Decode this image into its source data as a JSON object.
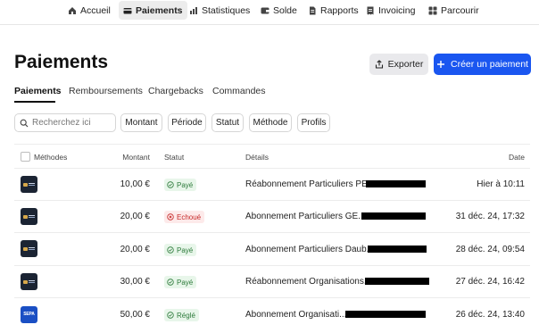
{
  "nav": {
    "items": [
      {
        "label": "Accueil",
        "icon": "home-icon"
      },
      {
        "label": "Paiements",
        "icon": "card-icon"
      },
      {
        "label": "Statistiques",
        "icon": "bar-chart-icon"
      },
      {
        "label": "Solde",
        "icon": "wallet-icon"
      },
      {
        "label": "Rapports",
        "icon": "document-icon"
      },
      {
        "label": "Invoicing",
        "icon": "invoice-icon"
      },
      {
        "label": "Parcourir",
        "icon": "grid-icon"
      }
    ],
    "active": "Paiements"
  },
  "header": {
    "title": "Paiements",
    "export_label": "Exporter",
    "create_label": "Créer un paiement"
  },
  "tabs": [
    {
      "label": "Paiements",
      "active": true
    },
    {
      "label": "Remboursements",
      "active": false
    },
    {
      "label": "Chargebacks",
      "active": false
    },
    {
      "label": "Commandes",
      "active": false
    }
  ],
  "filters": {
    "search_placeholder": "Recherchez ici",
    "chips": [
      "Montant",
      "Période",
      "Statut",
      "Méthode",
      "Profils"
    ]
  },
  "table": {
    "columns": {
      "methods": "Méthodes",
      "amount": "Montant",
      "status": "Statut",
      "details": "Détails",
      "date": "Date"
    },
    "rows": [
      {
        "method": "card",
        "amount": "10,00 €",
        "status": "Payé",
        "status_type": "ok",
        "details": "Réabonnement Particuliers PE...",
        "date": "Hier à 10:11"
      },
      {
        "method": "card",
        "amount": "20,00 €",
        "status": "Echoué",
        "status_type": "err",
        "details": "Abonnement Particuliers GE...",
        "date": "31 déc. 24, 17:32"
      },
      {
        "method": "card",
        "amount": "20,00 €",
        "status": "Payé",
        "status_type": "ok",
        "details": "Abonnement Particuliers Daub...",
        "date": "28 déc. 24, 09:54"
      },
      {
        "method": "card",
        "amount": "30,00 €",
        "status": "Payé",
        "status_type": "ok",
        "details": "Réabonnement Organisations...",
        "date": "27 déc. 24, 16:42"
      },
      {
        "method": "sepa",
        "method_label": "SEPA",
        "amount": "50,00 €",
        "status": "Réglé",
        "status_type": "ok",
        "details": "Abonnement Organisati...",
        "date": "26 déc. 24, 13:40"
      }
    ]
  },
  "colors": {
    "accent": "#1a56f0",
    "success_bg": "#e8f6ea",
    "success_text": "#2c7a3a",
    "error_bg": "#fdeaea",
    "error_text": "#c62828"
  }
}
